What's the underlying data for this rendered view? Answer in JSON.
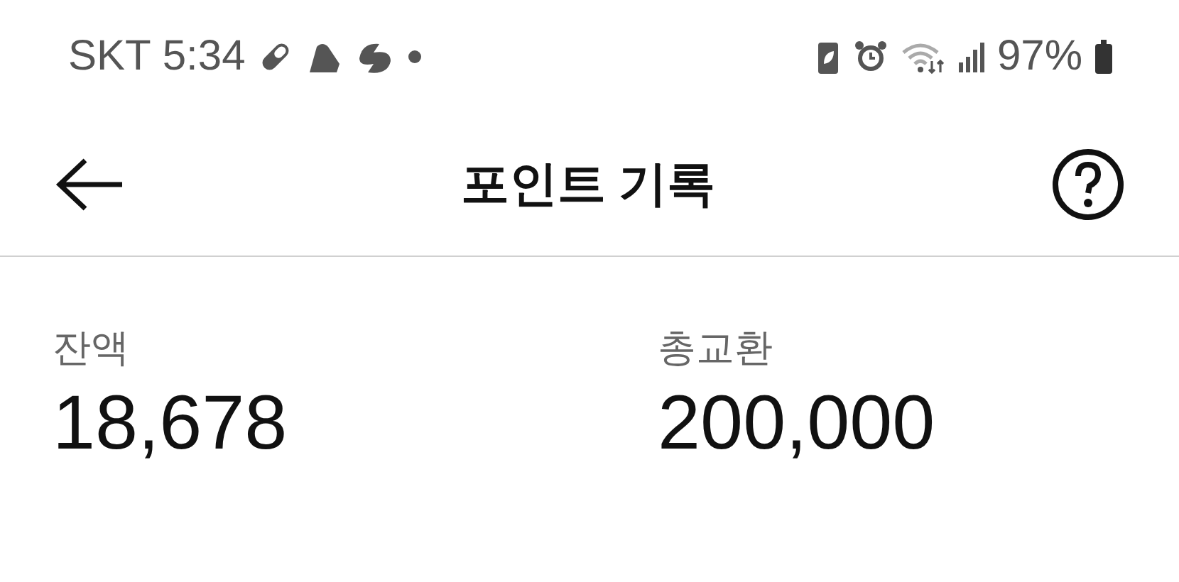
{
  "status_bar": {
    "carrier": "SKT",
    "time": "5:34",
    "battery": "97%"
  },
  "header": {
    "title": "포인트 기록"
  },
  "summary": [
    {
      "label": "잔액",
      "value": "18,678"
    },
    {
      "label": "총교환",
      "value": "200,000"
    }
  ]
}
